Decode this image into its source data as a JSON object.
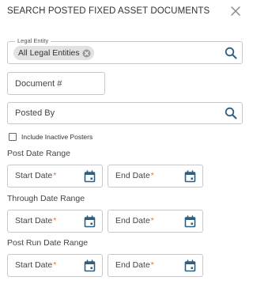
{
  "header": {
    "title": "SEARCH POSTED FIXED ASSET DOCUMENTS",
    "close_icon": "close-icon"
  },
  "legal_entity": {
    "label": "Legal Entity",
    "chip_label": "All Legal Entities",
    "chip_remove_icon": "circle-x-icon",
    "search_icon": "search-icon"
  },
  "document": {
    "placeholder": "Document #"
  },
  "posted_by": {
    "placeholder": "Posted By",
    "search_icon": "search-icon"
  },
  "include_inactive": {
    "label": "Include Inactive Posters",
    "checked": false
  },
  "post_date_range": {
    "label": "Post Date Range",
    "start_label": "Start Date",
    "end_label": "End Date",
    "required_mark": "*"
  },
  "through_date_range": {
    "label": "Through Date Range",
    "start_label": "Start Date",
    "end_label": "End Date",
    "required_mark": "*"
  },
  "post_run_date_range": {
    "label": "Post Run Date Range",
    "start_label": "Start Date",
    "end_label": "End Date",
    "required_mark": "*"
  },
  "colors": {
    "required": "#e0782b",
    "icon": "#2e5f80",
    "border": "#c8c8c8",
    "chip_bg": "#e2e2e2"
  }
}
